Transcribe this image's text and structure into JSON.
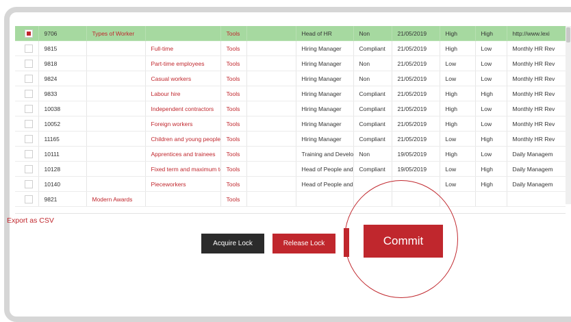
{
  "table": {
    "rows": [
      {
        "checked": true,
        "id": "9706",
        "group": "Types of Worker",
        "item": "",
        "type": "Tools",
        "blank": "",
        "role": "Head of HR",
        "status": "Non",
        "date": "21/05/2019",
        "impact": "High",
        "priority": "High",
        "link": "http://www.lexi",
        "highlight": true
      },
      {
        "checked": false,
        "id": "9815",
        "group": "",
        "item": "Full-time",
        "type": "Tools",
        "blank": "",
        "role": "Hiring Manager",
        "status": "Compliant",
        "date": "21/05/2019",
        "impact": "High",
        "priority": "Low",
        "link": "Monthly HR Rev"
      },
      {
        "checked": false,
        "id": "9818",
        "group": "",
        "item": "Part-time employees",
        "type": "Tools",
        "blank": "",
        "role": "Hiring Manager",
        "status": "Non",
        "date": "21/05/2019",
        "impact": "Low",
        "priority": "Low",
        "link": "Monthly HR Rev"
      },
      {
        "checked": false,
        "id": "9824",
        "group": "",
        "item": "Casual workers",
        "type": "Tools",
        "blank": "",
        "role": "Hiring Manager",
        "status": "Non",
        "date": "21/05/2019",
        "impact": "Low",
        "priority": "Low",
        "link": "Monthly HR Rev"
      },
      {
        "checked": false,
        "id": "9833",
        "group": "",
        "item": "Labour hire",
        "type": "Tools",
        "blank": "",
        "role": "Hiring Manager",
        "status": "Compliant",
        "date": "21/05/2019",
        "impact": "High",
        "priority": "High",
        "link": "Monthly HR Rev"
      },
      {
        "checked": false,
        "id": "10038",
        "group": "",
        "item": "Independent contractors",
        "type": "Tools",
        "blank": "",
        "role": "Hiring Manager",
        "status": "Compliant",
        "date": "21/05/2019",
        "impact": "High",
        "priority": "Low",
        "link": "Monthly HR Rev"
      },
      {
        "checked": false,
        "id": "10052",
        "group": "",
        "item": "Foreign workers",
        "type": "Tools",
        "blank": "",
        "role": "Hiring Manager",
        "status": "Compliant",
        "date": "21/05/2019",
        "impact": "High",
        "priority": "Low",
        "link": "Monthly HR Rev"
      },
      {
        "checked": false,
        "id": "11165",
        "group": "",
        "item": "Children and young people",
        "type": "Tools",
        "blank": "",
        "role": "Hiring Manager",
        "status": "Compliant",
        "date": "21/05/2019",
        "impact": "Low",
        "priority": "High",
        "link": "Monthly HR Rev"
      },
      {
        "checked": false,
        "id": "10111",
        "group": "",
        "item": "Apprentices and trainees",
        "type": "Tools",
        "blank": "",
        "role": "Training and Develop",
        "status": "Non",
        "date": "19/05/2019",
        "impact": "High",
        "priority": "Low",
        "link": "Daily Managem"
      },
      {
        "checked": false,
        "id": "10128",
        "group": "",
        "item": "Fixed term and maximum te",
        "type": "Tools",
        "blank": "",
        "role": "Head of People and C",
        "status": "Compliant",
        "date": "19/05/2019",
        "impact": "Low",
        "priority": "High",
        "link": "Daily Managem"
      },
      {
        "checked": false,
        "id": "10140",
        "group": "",
        "item": "Pieceworkers",
        "type": "Tools",
        "blank": "",
        "role": "Head of People and C",
        "status": "",
        "date": "",
        "impact": "Low",
        "priority": "High",
        "link": "Daily Managem"
      },
      {
        "checked": false,
        "id": "9821",
        "group": "Modern Awards",
        "item": "",
        "type": "Tools",
        "blank": "",
        "role": "",
        "status": "",
        "date": "",
        "impact": "",
        "priority": "",
        "link": ""
      }
    ]
  },
  "export_label": "Export as CSV",
  "buttons": {
    "acquire": "Acquire Lock",
    "release": "Release Lock",
    "commit": "Commit"
  },
  "colors": {
    "accent_red": "#c0272d",
    "highlight_green": "#a6d9a0",
    "dark_button": "#2b2b2b"
  }
}
